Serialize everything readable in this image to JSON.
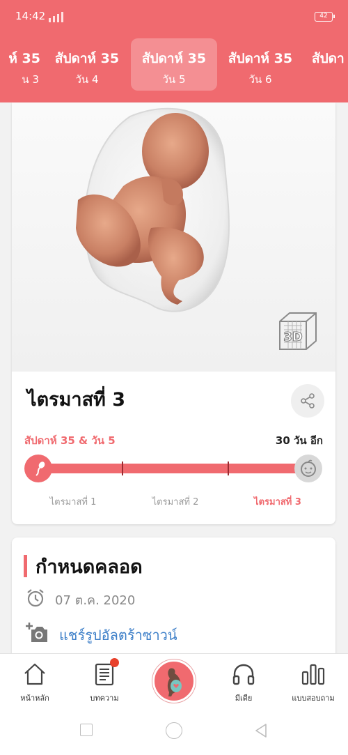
{
  "status_bar": {
    "time": "14:42",
    "battery": "42"
  },
  "day_tabs": [
    {
      "week": "ห์ 35",
      "day": "น 3",
      "active": false
    },
    {
      "week": "สัปดาห์ 35",
      "day": "วัน 4",
      "active": false
    },
    {
      "week": "สัปดาห์ 35",
      "day": "วัน 5",
      "active": true
    },
    {
      "week": "สัปดาห์ 35",
      "day": "วัน 6",
      "active": false
    },
    {
      "week": "สัปดา",
      "day": "",
      "active": false
    }
  ],
  "fetus_card": {
    "trimester_title": "ไตรมาสที่ 3",
    "badge_3d": "3D",
    "week_day_label": "สัปดาห์ 35 & วัน 5",
    "days_left": "30 วัน อีก",
    "trimester_labels": [
      "ไตรมาสที่ 1",
      "ไตรมาสที่ 2",
      "ไตรมาสที่ 3"
    ],
    "active_trimester": 3
  },
  "due_card": {
    "title": "กำหนดคลอด",
    "due_date": "07 ต.ค. 2020",
    "ultrasound_link": "แชร์รูปอัลตร้าซาวน์"
  },
  "bottom_nav": {
    "items": [
      {
        "label": "หน้าหลัก",
        "icon": "home-icon"
      },
      {
        "label": "บทความ",
        "icon": "article-icon"
      },
      {
        "label": "",
        "icon": "pregnancy-icon"
      },
      {
        "label": "มีเดีย",
        "icon": "headphones-icon"
      },
      {
        "label": "แบบสอบถาม",
        "icon": "poll-icon"
      }
    ]
  },
  "colors": {
    "accent": "#f06a6f",
    "link": "#3d7fc8",
    "badge": "#e8412c"
  }
}
